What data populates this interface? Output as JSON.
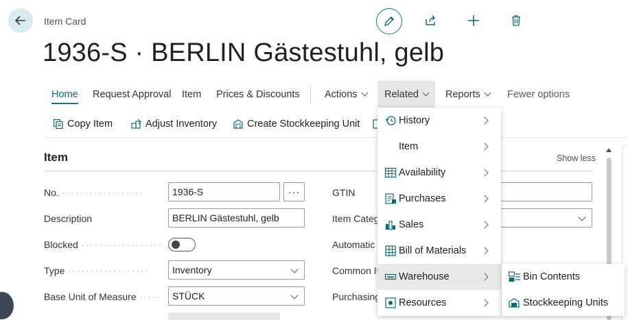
{
  "header": {
    "caption": "Item Card",
    "title": "1936-S · BERLIN Gästestuhl, gelb",
    "icons": [
      "back-arrow-icon",
      "edit-pencil-icon",
      "share-icon",
      "plus-icon",
      "trash-icon"
    ]
  },
  "menu": {
    "items": [
      {
        "label": "Home",
        "active": true
      },
      {
        "label": "Request Approval"
      },
      {
        "label": "Item"
      },
      {
        "label": "Prices & Discounts"
      },
      {
        "label": "Actions",
        "dropdown": true
      },
      {
        "label": "Related",
        "dropdown": true,
        "open": true
      },
      {
        "label": "Reports",
        "dropdown": true
      },
      {
        "label": "Fewer options"
      }
    ]
  },
  "actions": [
    {
      "label": "Copy Item",
      "icon": "copy-item-icon"
    },
    {
      "label": "Adjust Inventory",
      "icon": "adjust-inventory-icon"
    },
    {
      "label": "Create Stockkeeping Unit",
      "icon": "create-sku-icon"
    }
  ],
  "fasttab": {
    "title": "Item",
    "toggle_label": "Show less"
  },
  "fields_left": [
    {
      "label": "No.",
      "value": "1936-S"
    },
    {
      "label": "Description",
      "value": "BERLIN Gästestuhl, gelb"
    },
    {
      "label": "Blocked",
      "value": "off"
    },
    {
      "label": "Type",
      "value": "Inventory"
    },
    {
      "label": "Base Unit of Measure",
      "value": "STÜCK"
    }
  ],
  "fields_right": [
    {
      "label": "GTIN"
    },
    {
      "label": "Item Categ"
    },
    {
      "label": "Automatic"
    },
    {
      "label": "Common It"
    },
    {
      "label": "Purchasing"
    }
  ],
  "lookup_label": "···",
  "related_menu": {
    "items": [
      {
        "label": "History",
        "icon": "history-icon"
      },
      {
        "label": "Item",
        "icon": ""
      },
      {
        "label": "Availability",
        "icon": "availability-icon"
      },
      {
        "label": "Purchases",
        "icon": "purchases-icon"
      },
      {
        "label": "Sales",
        "icon": "sales-icon"
      },
      {
        "label": "Bill of Materials",
        "icon": "bill-of-materials-icon"
      },
      {
        "label": "Warehouse",
        "icon": "warehouse-icon",
        "highlighted": true
      },
      {
        "label": "Resources",
        "icon": "resources-icon"
      }
    ]
  },
  "warehouse_submenu": {
    "items": [
      {
        "label": "Bin Contents",
        "icon": "bin-contents-icon"
      },
      {
        "label": "Stockkeeping Units",
        "icon": "stockkeeping-units-icon"
      }
    ]
  },
  "colors": {
    "accent": "#0b7b82",
    "icon_teal": "#0b6a72",
    "hover_bg": "#e9e9e9",
    "back_bg": "#d7ecef"
  }
}
